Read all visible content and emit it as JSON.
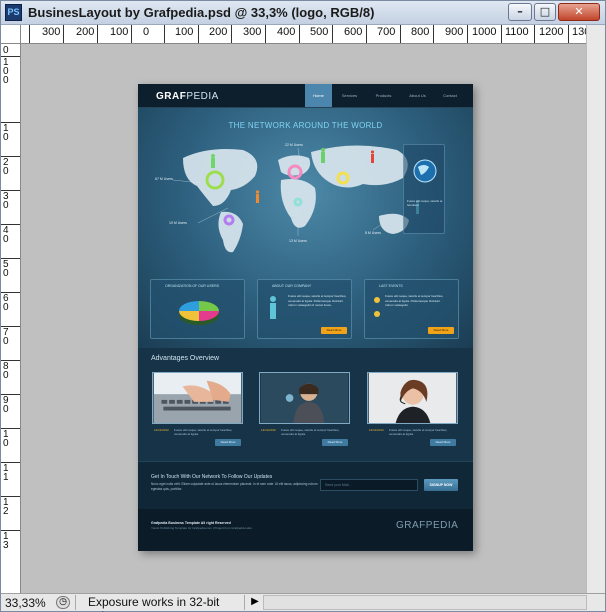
{
  "window": {
    "app_icon": "PS",
    "title": "BusinesLayout by Grafpedia.psd @ 33,3% (logo, RGB/8)",
    "minimize_label": "–",
    "maximize_label": "□",
    "close_label": "✕"
  },
  "ruler_top": {
    "labels": [
      "300",
      "200",
      "100",
      "0",
      "100",
      "200",
      "300",
      "400",
      "500",
      "600",
      "700",
      "800",
      "900",
      "1000",
      "1100",
      "1200",
      "130"
    ]
  },
  "ruler_left": {
    "labels": [
      "0",
      "1 0 0",
      "1 0",
      "2 0",
      "3 0",
      "4 0",
      "5 0",
      "6 0",
      "7 0",
      "8 0",
      "9 0",
      "1 0",
      "1 1",
      "1 2",
      "1 3"
    ]
  },
  "status": {
    "zoom": "33,33%",
    "message": "Exposure works in 32-bit only",
    "menu_arrow": "▶"
  },
  "document": {
    "logo_main": "GRAF",
    "logo_accent": "PEDIA",
    "nav": [
      "Home",
      "Services",
      "Products",
      "About Us",
      "Contact"
    ],
    "hero_title": "THE NETWORK AROUND THE WORLD",
    "map_labels": [
      "22 M Users",
      "67 M Users",
      "19 M Users",
      "13 M Users",
      "8 M Users"
    ],
    "side_panel_text": "Fusce elit neque, iaculis et hendrerit",
    "boxes": [
      {
        "title": "ORGANIZATION OF OUR USERS",
        "text": "",
        "button": ""
      },
      {
        "title": "ABOUT OUR COMPANY",
        "text": "Fusce elit neque, iaculis et tempor faucibus, venenatis at ligula. Pellentesque tincidunt rutrum velaegulis id metus fusce.",
        "button": "Read More"
      },
      {
        "title": "LAST EVENTS",
        "text": "Fusce elit neque, iaculis et tempor faucibus, venenatis at ligula. Pellentesque tincidunt rutrum velaegulis.",
        "button": "Read More"
      }
    ],
    "advantages_title": "Advantages Overview",
    "thumbs": [
      {
        "date": "12/11/2012",
        "text": "Fusce elit neque, iaculis et tempor faucibus, venenatis at ligula.",
        "button": "Read More"
      },
      {
        "date": "12/11/2012",
        "text": "Fusce elit neque, iaculis et tempor faucibus, venenatis at ligula.",
        "button": "Read More"
      },
      {
        "date": "12/11/2012",
        "text": "Fusce elit neque, iaculis et tempor faucibus, venenatis at ligula.",
        "button": "Read More"
      }
    ],
    "touch_title": "Get In Touch With Our Network To Follow Our Updates",
    "touch_text": "Nunc eget nulla velit. Etiam vulputate ante ut lacus elementum placerat. In et sem ante. Ut elit lacus, adipiscing rutrum egestas quis, porttitor.",
    "email_placeholder": "Send your Mail...",
    "signup_button": "SIGNUP NOW",
    "footer_copy": "Grafpedia Business Template All right Reserved",
    "footer_small": "Yourst Publishing Template for Grafpedia.com | Project from Grafpedia Labs",
    "footer_logo": "GRAFPEDIA"
  },
  "colors": {
    "accent": "#4d86ad",
    "button_orange": "#f0a318",
    "doc_bg": "#12293a"
  }
}
